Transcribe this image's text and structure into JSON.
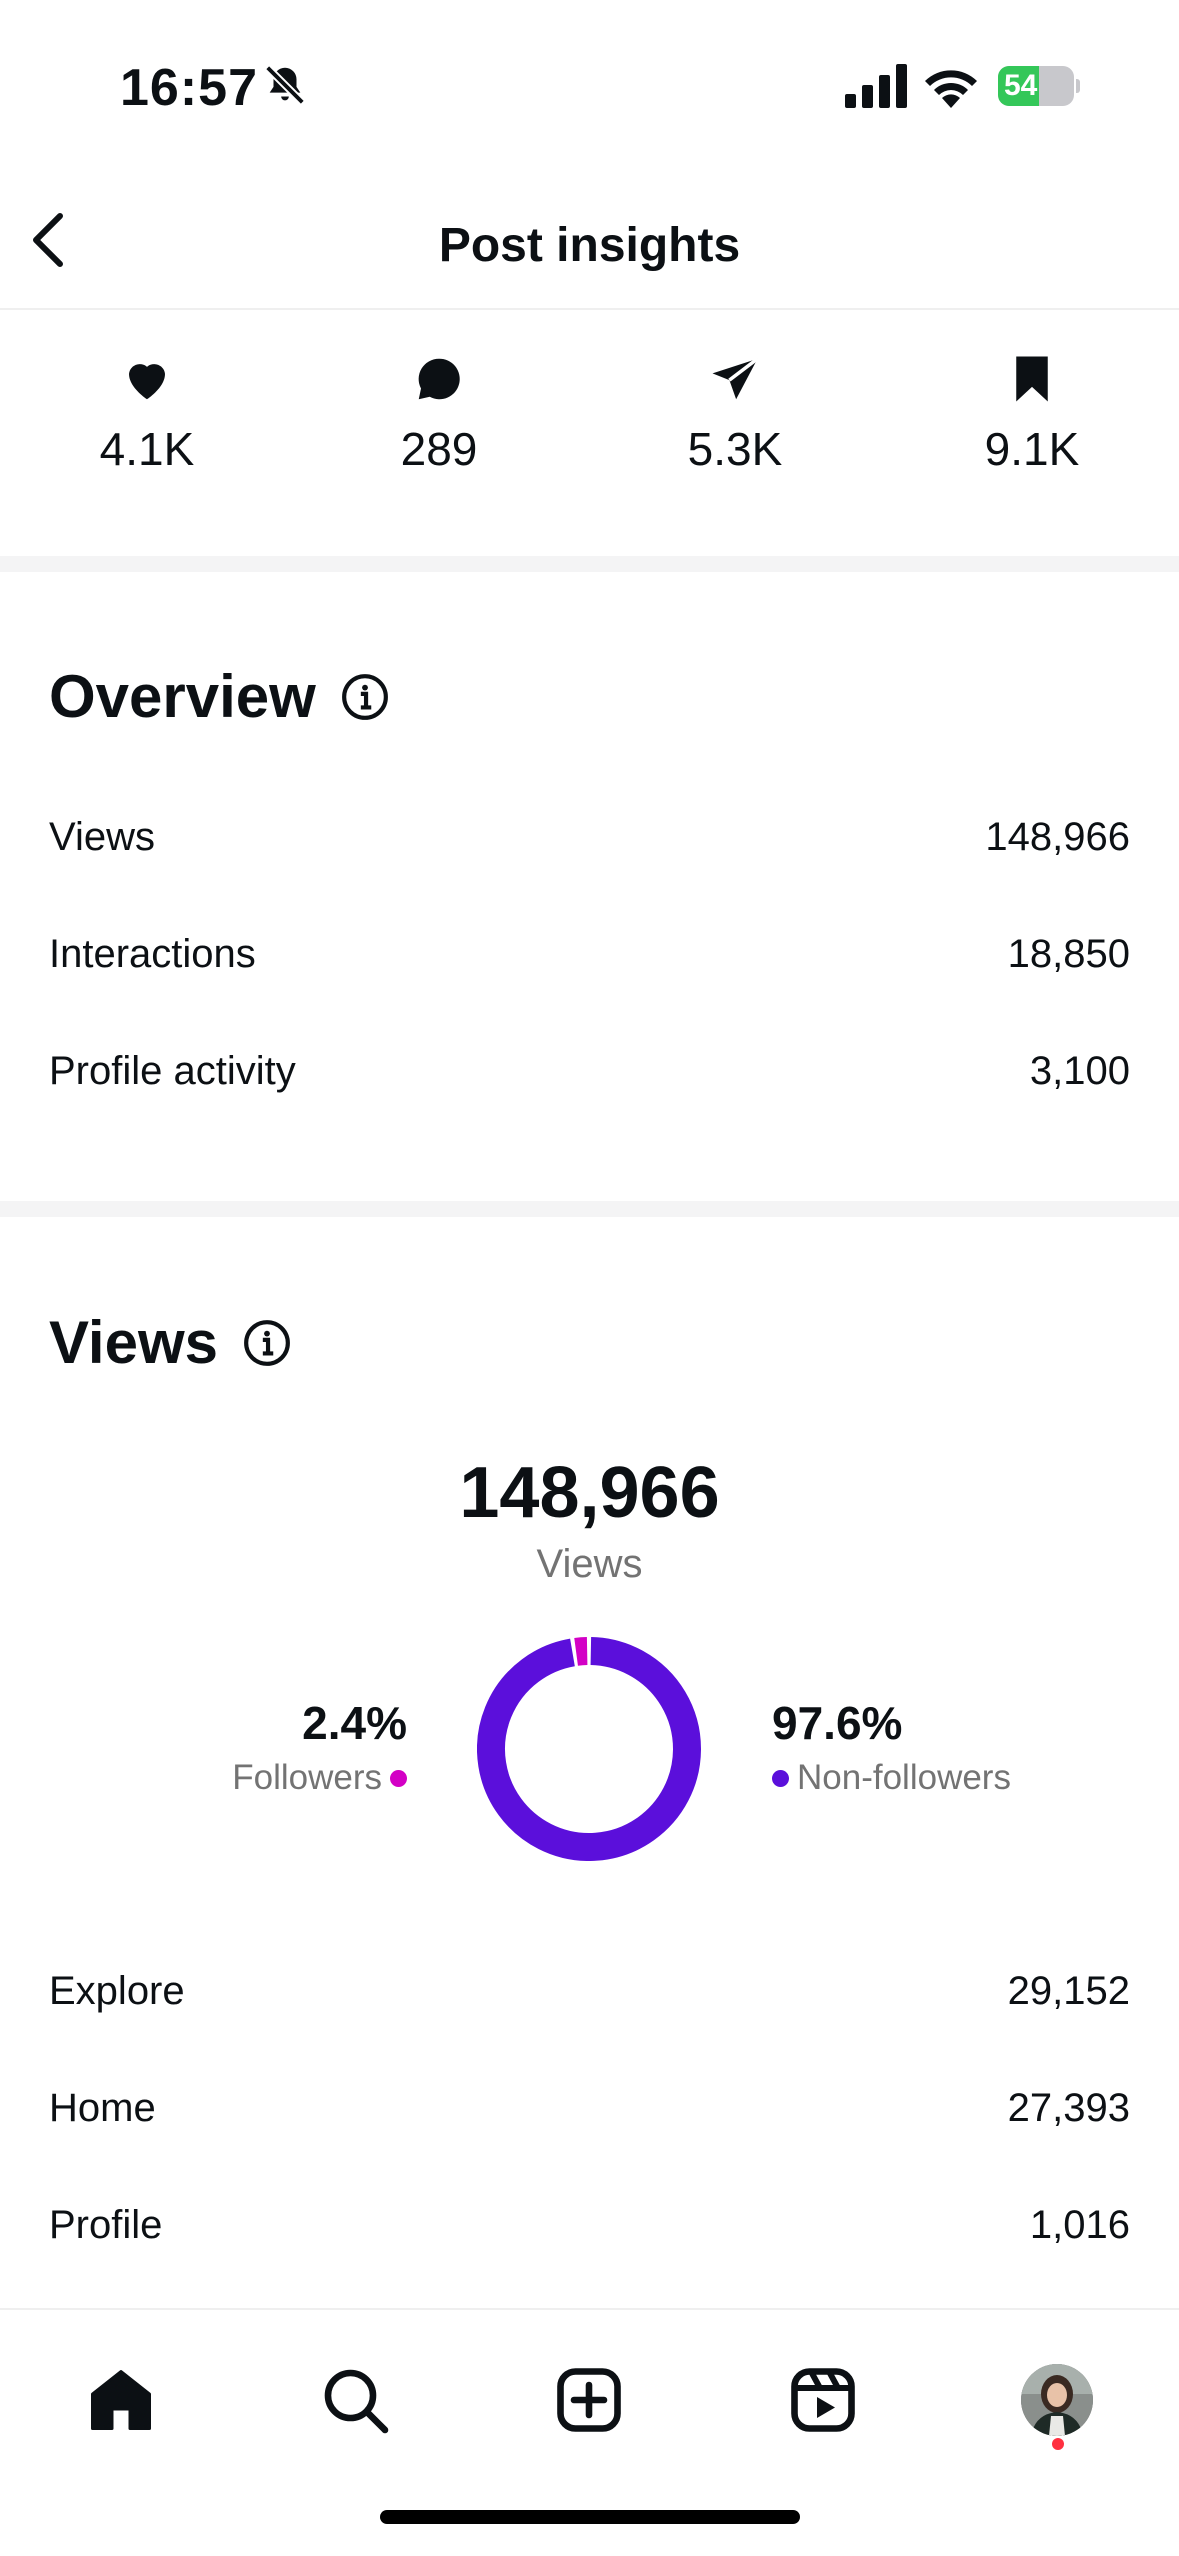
{
  "status_bar": {
    "time": "16:57",
    "battery": "54",
    "battery_level": 0.54
  },
  "header": {
    "title": "Post insights"
  },
  "stats": [
    {
      "icon": "heart-icon",
      "value": "4.1K"
    },
    {
      "icon": "comment-icon",
      "value": "289"
    },
    {
      "icon": "share-icon",
      "value": "5.3K"
    },
    {
      "icon": "bookmark-icon",
      "value": "9.1K"
    }
  ],
  "overview": {
    "title": "Overview",
    "rows": [
      {
        "label": "Views",
        "value": "148,966"
      },
      {
        "label": "Interactions",
        "value": "18,850"
      },
      {
        "label": "Profile activity",
        "value": "3,100"
      }
    ]
  },
  "views": {
    "title": "Views",
    "total": "148,966",
    "total_label": "Views",
    "followers_pct": "2.4%",
    "followers_label": "Followers",
    "non_followers_pct": "97.6%",
    "non_followers_label": "Non-followers",
    "followers_share": 0.024,
    "colors": {
      "followers": "#d300c5",
      "non_followers": "#5b0fdb"
    },
    "sources": [
      {
        "label": "Explore",
        "value": "29,152"
      },
      {
        "label": "Home",
        "value": "27,393"
      },
      {
        "label": "Profile",
        "value": "1,016"
      }
    ]
  },
  "nav": [
    "home-icon",
    "search-icon",
    "create-icon",
    "reels-icon",
    "profile-avatar"
  ]
}
